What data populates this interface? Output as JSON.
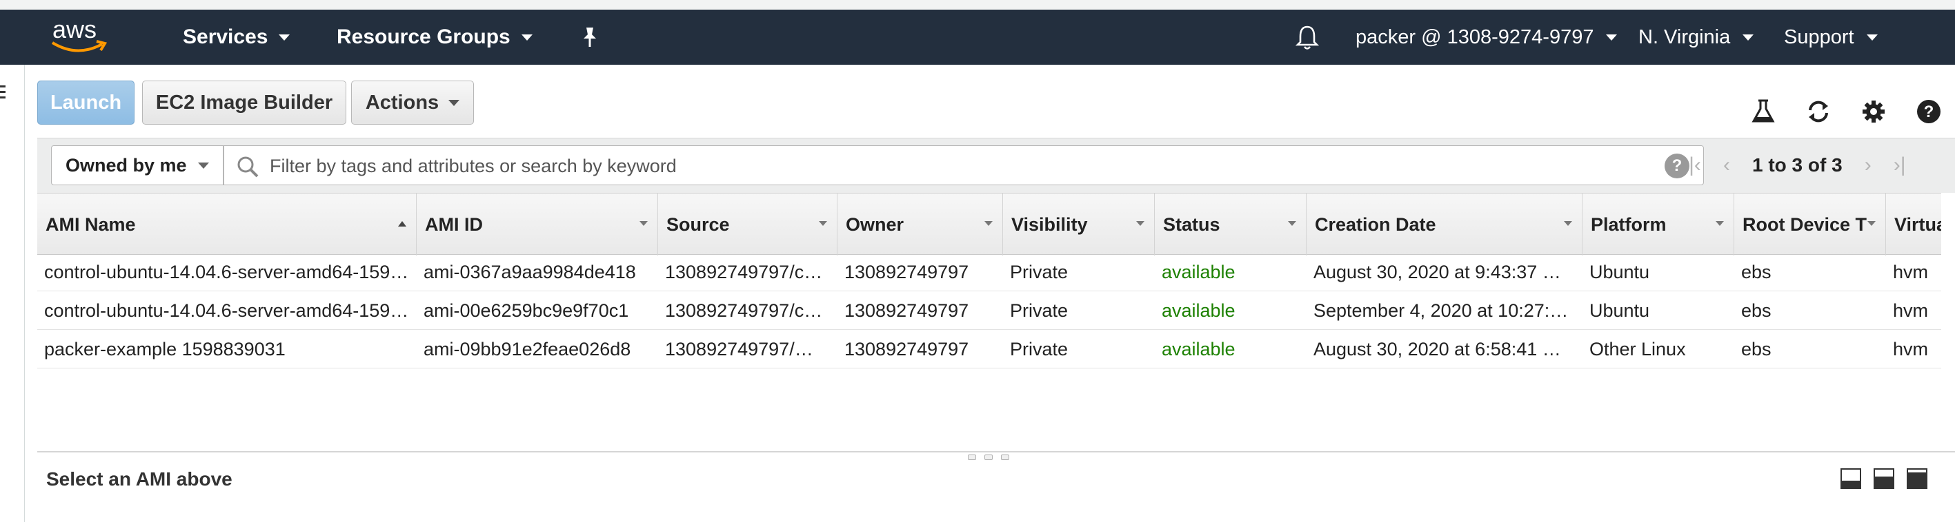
{
  "nav": {
    "logo_text": "aws",
    "services": "Services",
    "resource_groups": "Resource Groups",
    "account": "packer @ 1308-9274-9797",
    "region": "N. Virginia",
    "support": "Support",
    "icons": [
      "pin-icon",
      "bell-icon"
    ]
  },
  "toolbar": {
    "launch": "Launch",
    "image_builder": "EC2 Image Builder",
    "actions": "Actions",
    "icons": [
      "flask-icon",
      "refresh-icon",
      "gear-icon",
      "help-icon"
    ]
  },
  "filter": {
    "owned_by": "Owned by me",
    "placeholder": "Filter by tags and attributes or search by keyword",
    "help": "?",
    "range": "1 to 3 of 3"
  },
  "table": {
    "columns": [
      "AMI Name",
      "AMI ID",
      "Source",
      "Owner",
      "Visibility",
      "Status",
      "Creation Date",
      "Platform",
      "Root Device T",
      "Virtua"
    ],
    "rows": [
      [
        "control-ubuntu-14.04.6-server-amd64-159…",
        "ami-0367a9aa9984de418",
        "130892749797/c…",
        "130892749797",
        "Private",
        "available",
        "August 30, 2020 at 9:43:37 …",
        "Ubuntu",
        "ebs",
        "hvm"
      ],
      [
        "control-ubuntu-14.04.6-server-amd64-159…",
        "ami-00e6259bc9e9f70c1",
        "130892749797/c…",
        "130892749797",
        "Private",
        "available",
        "September 4, 2020 at 10:27:…",
        "Ubuntu",
        "ebs",
        "hvm"
      ],
      [
        "packer-example 1598839031",
        "ami-09bb91e2feae026d8",
        "130892749797/…",
        "130892749797",
        "Private",
        "available",
        "August 30, 2020 at 6:58:41 …",
        "Other Linux",
        "ebs",
        "hvm"
      ]
    ]
  },
  "details": {
    "empty_text": "Select an AMI above"
  },
  "colors": {
    "nav_bg": "#232f3e",
    "launch_bg": "#8ebde4",
    "status_available": "#1d8102"
  }
}
